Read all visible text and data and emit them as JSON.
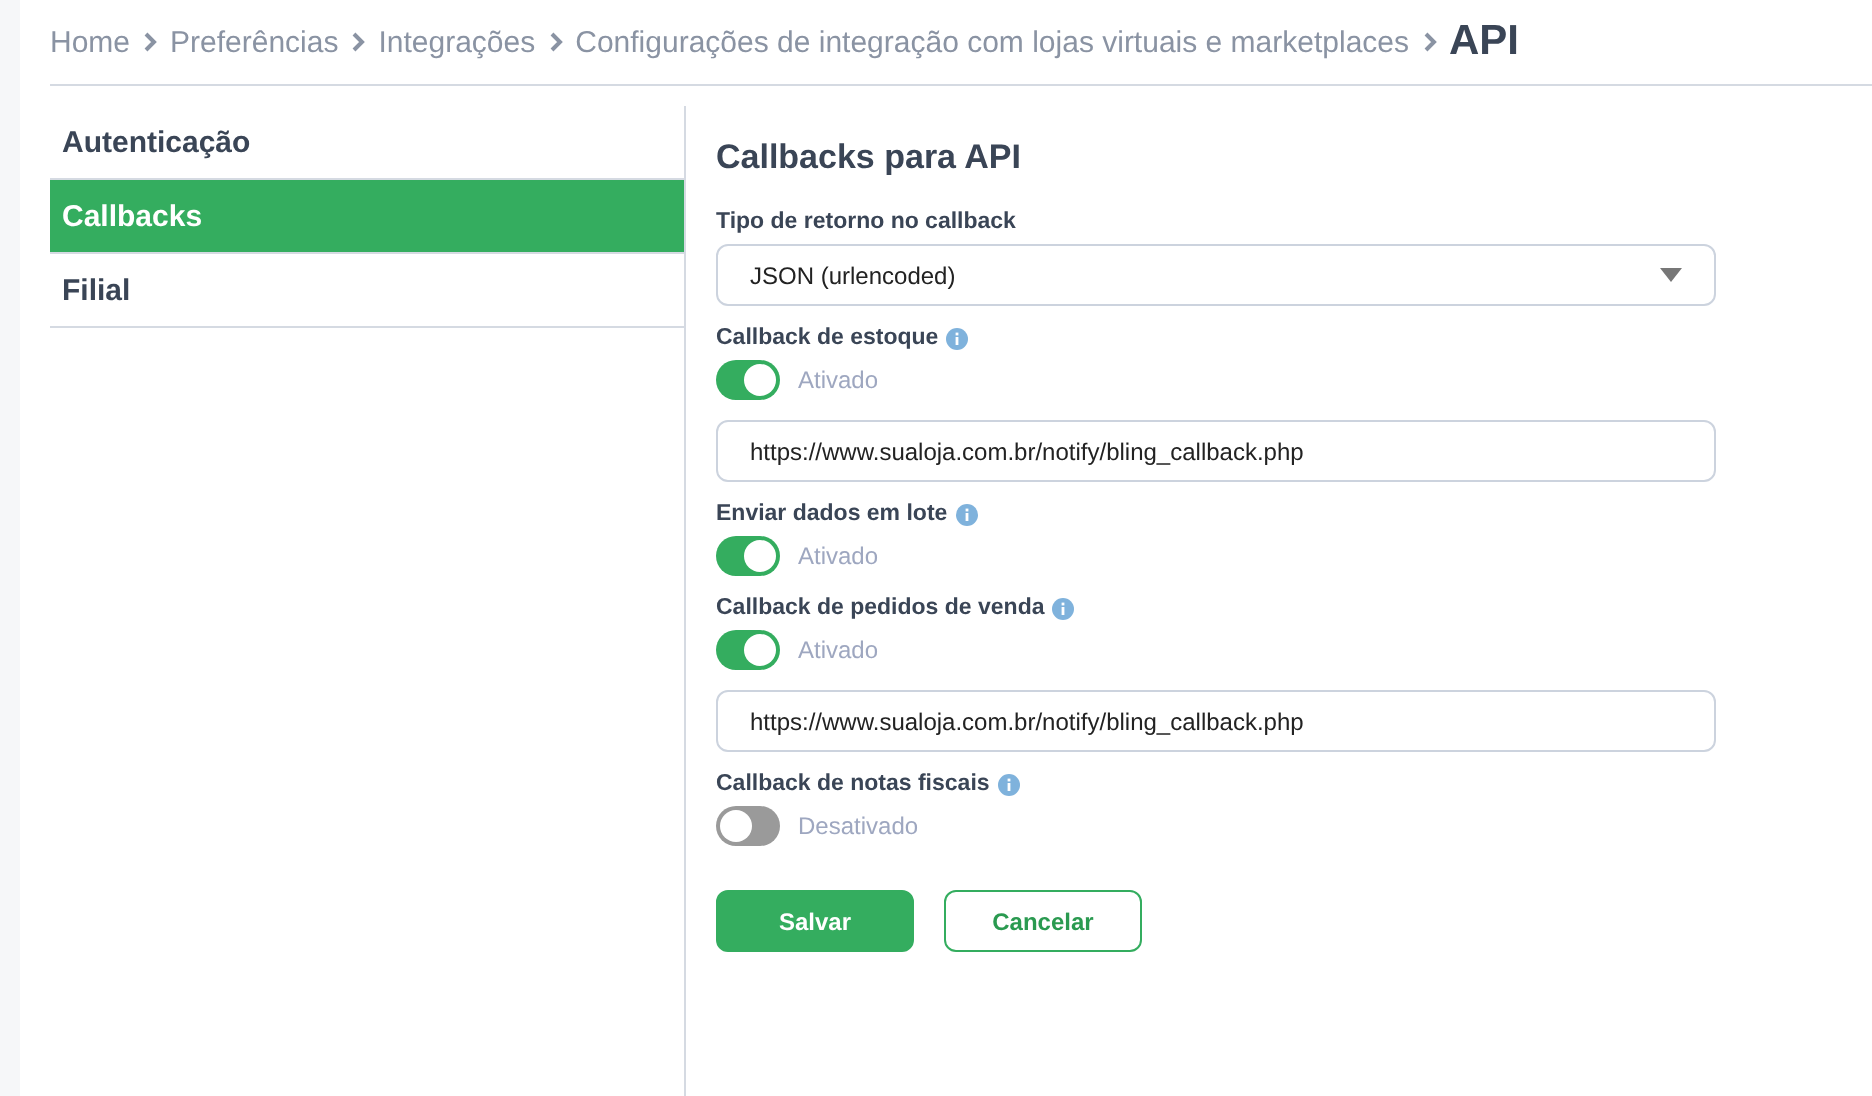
{
  "breadcrumb": [
    {
      "label": "Home",
      "current": false
    },
    {
      "label": "Preferências",
      "current": false
    },
    {
      "label": "Integrações",
      "current": false
    },
    {
      "label": "Configurações de integração com lojas virtuais e marketplaces",
      "current": false
    },
    {
      "label": "API",
      "current": true
    }
  ],
  "sidebar": {
    "items": [
      {
        "label": "Autenticação",
        "selected": false
      },
      {
        "label": "Callbacks",
        "selected": true
      },
      {
        "label": "Filial",
        "selected": false
      }
    ]
  },
  "form": {
    "title": "Callbacks para API",
    "fields": [
      {
        "kind": "select",
        "label": "Tipo de retorno no callback",
        "value": "JSON (urlencoded)"
      },
      {
        "kind": "toggle",
        "label": "Callback de estoque",
        "on": true,
        "state_text": "Ativado",
        "url": "https://www.sualoja.com.br/notify/bling_callback.php"
      },
      {
        "kind": "toggle",
        "label": "Enviar dados em lote",
        "on": true,
        "state_text": "Ativado"
      },
      {
        "kind": "toggle",
        "label": "Callback de pedidos de venda",
        "on": true,
        "state_text": "Ativado",
        "url": "https://www.sualoja.com.br/notify/bling_callback.php"
      },
      {
        "kind": "toggle",
        "label": "Callback de notas fiscais",
        "on": false,
        "state_text": "Desativado"
      }
    ],
    "buttons": [
      {
        "kind": "primary",
        "label": "Salvar"
      },
      {
        "kind": "secondary",
        "label": "Cancelar"
      }
    ]
  }
}
